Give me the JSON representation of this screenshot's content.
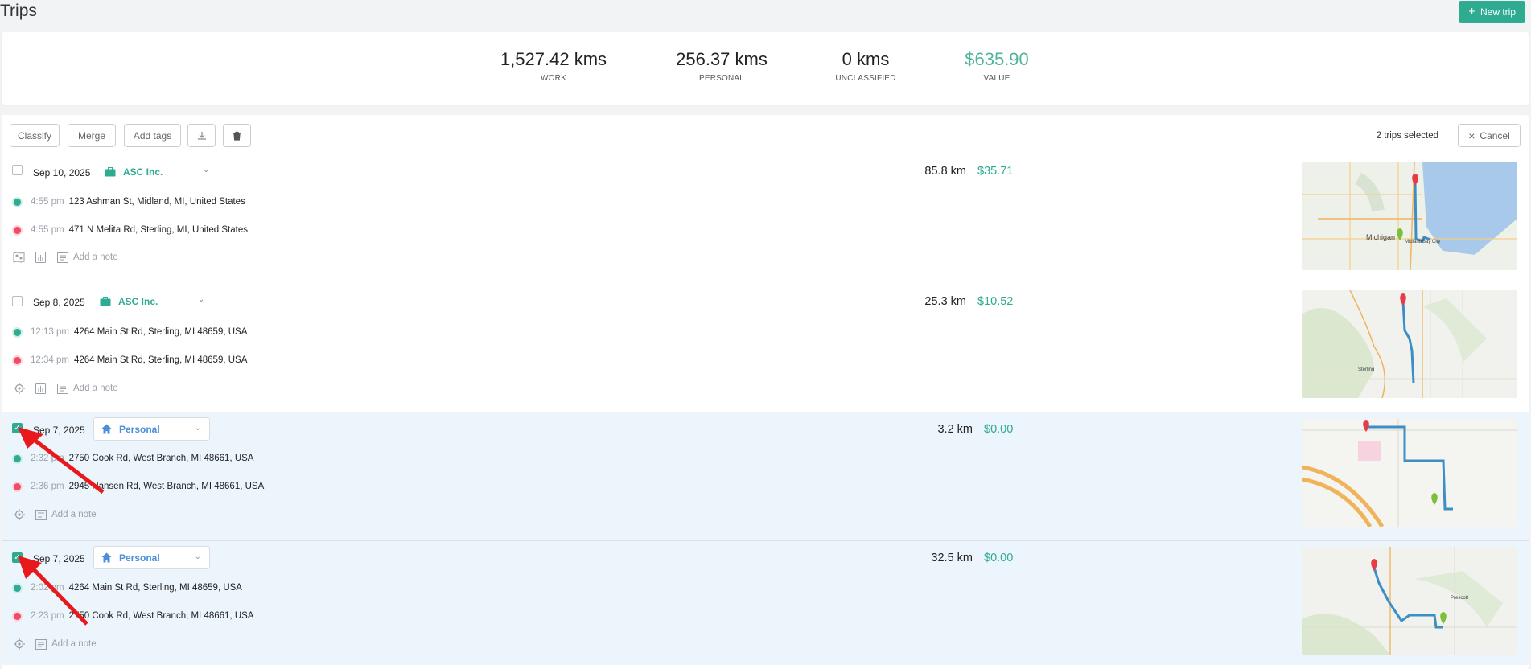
{
  "page": {
    "title": "Trips",
    "new_trip_label": "New trip"
  },
  "summary": {
    "work": {
      "value": "1,527.42 kms",
      "label": "WORK"
    },
    "personal": {
      "value": "256.37 kms",
      "label": "PERSONAL"
    },
    "unclassified": {
      "value": "0 kms",
      "label": "UNCLASSIFIED"
    },
    "value": {
      "value": "$635.90",
      "label": "VALUE"
    }
  },
  "toolbar": {
    "classify": "Classify",
    "merge": "Merge",
    "add_tags": "Add tags",
    "selected_text": "2 trips selected",
    "cancel": "Cancel"
  },
  "trips": [
    {
      "date": "Sep 10, 2025",
      "category": "ASC Inc.",
      "category_type": "work",
      "selected": false,
      "distance": "85.8 km",
      "amount": "$35.71",
      "start_time": "4:55 pm",
      "start_address": "123 Ashman St, Midland, MI, United States",
      "end_time": "4:55 pm",
      "end_address": "471 N Melita Rd, Sterling, MI, United States",
      "note_placeholder": "Add a note"
    },
    {
      "date": "Sep 8, 2025",
      "category": "ASC Inc.",
      "category_type": "work",
      "selected": false,
      "distance": "25.3 km",
      "amount": "$10.52",
      "start_time": "12:13 pm",
      "start_address": "4264 Main St Rd, Sterling, MI 48659, USA",
      "end_time": "12:34 pm",
      "end_address": "4264 Main St Rd, Sterling, MI 48659, USA",
      "note_placeholder": "Add a note"
    },
    {
      "date": "Sep 7, 2025",
      "category": "Personal",
      "category_type": "personal",
      "selected": true,
      "distance": "3.2 km",
      "amount": "$0.00",
      "start_time": "2:32 pm",
      "start_address": "2750 Cook Rd, West Branch, MI 48661, USA",
      "end_time": "2:36 pm",
      "end_address": "2945 Hansen Rd, West Branch, MI 48661, USA",
      "note_placeholder": "Add a note"
    },
    {
      "date": "Sep 7, 2025",
      "category": "Personal",
      "category_type": "personal",
      "selected": true,
      "distance": "32.5 km",
      "amount": "$0.00",
      "start_time": "2:02 pm",
      "start_address": "4264 Main St Rd, Sterling, MI 48659, USA",
      "end_time": "2:23 pm",
      "end_address": "2750 Cook Rd, West Branch, MI 48661, USA",
      "note_placeholder": "Add a note"
    }
  ],
  "maps": [
    {
      "labels": [
        "Midland",
        "Michigan",
        "Bay City"
      ]
    },
    {
      "labels": [
        "Sterling"
      ]
    },
    {
      "labels": []
    },
    {
      "labels": [
        "Prescott"
      ]
    }
  ],
  "colors": {
    "accent": "#2eab90",
    "personal": "#4a90d9",
    "route": "#3b8fc6",
    "pin_start": "#7cbf3a",
    "pin_end": "#e53c47",
    "annotation_arrow": "#e8191c"
  }
}
